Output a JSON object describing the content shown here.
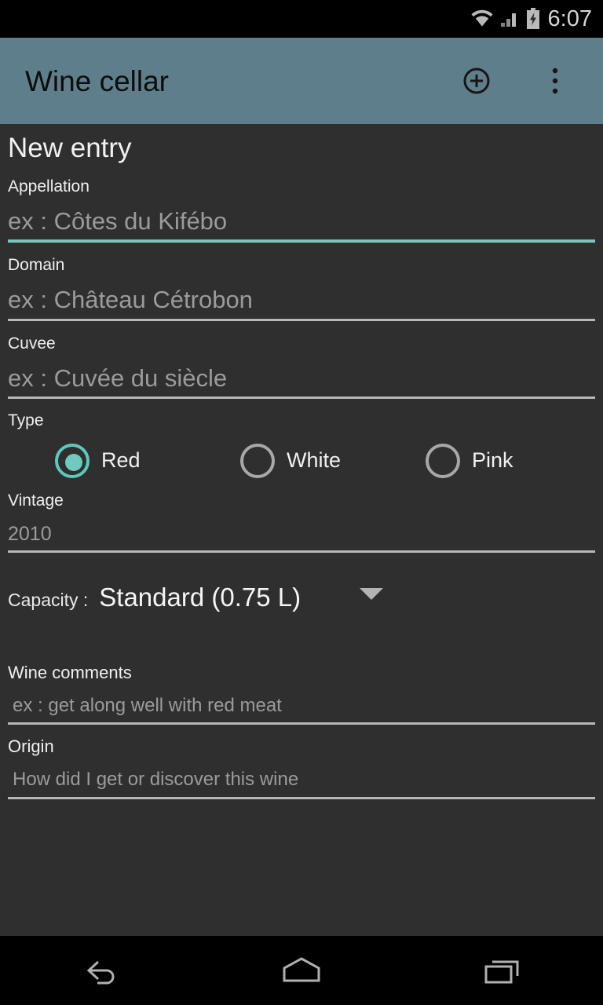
{
  "status_bar": {
    "time": "6:07",
    "icons": [
      "wifi-icon",
      "cell-signal-icon",
      "battery-charging-icon"
    ]
  },
  "action_bar": {
    "title": "Wine cellar",
    "add_label": "add-entry",
    "overflow_label": "more-options",
    "background_color": "#5f7e8c"
  },
  "theme": {
    "background_color": "#2f2f2f",
    "accent_color": "#78c7bd",
    "underline_color": "#b8b8b8",
    "text_color": "#f0f0f0",
    "hint_color": "#9b9b9b"
  },
  "form": {
    "title": "New entry",
    "fields": [
      {
        "label": "Appellation",
        "placeholder": "ex : Côtes du Kifébo",
        "value": "",
        "focused": true
      },
      {
        "label": "Domain",
        "placeholder": "ex : Château Cétrobon",
        "value": "",
        "focused": false
      },
      {
        "label": "Cuvee",
        "placeholder": "ex : Cuvée du siècle",
        "value": "",
        "focused": false
      }
    ],
    "type": {
      "label": "Type",
      "options": [
        {
          "label": "Red",
          "checked": true
        },
        {
          "label": "White",
          "checked": false
        },
        {
          "label": "Pink",
          "checked": false
        }
      ]
    },
    "vintage": {
      "label": "Vintage",
      "placeholder": "2010",
      "value": ""
    },
    "capacity": {
      "label": "Capacity :",
      "selected": "Standard (0.75 L)",
      "caret": "chevron-down-icon"
    },
    "comments": {
      "label": "Wine comments",
      "placeholder": "ex : get along well with red meat",
      "value": ""
    },
    "origin": {
      "label": "Origin",
      "placeholder": "How did I get or discover this wine",
      "value": ""
    }
  },
  "nav_bar": {
    "buttons": [
      "back-icon",
      "home-icon",
      "recents-icon"
    ]
  }
}
